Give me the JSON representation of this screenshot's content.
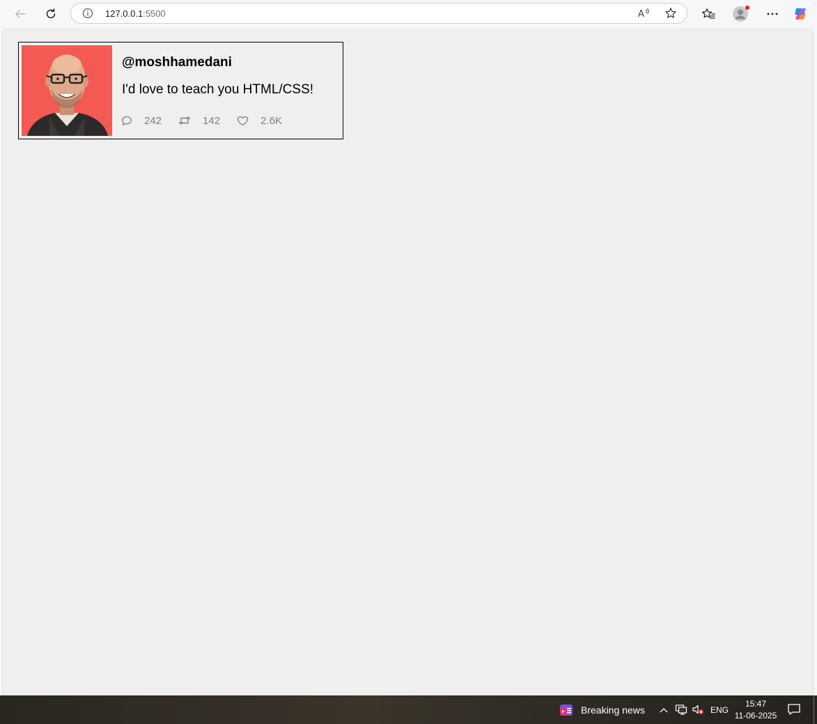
{
  "browser": {
    "url_host": "127.0.0.1",
    "url_port": ":5500",
    "icons": [
      "back-arrow-icon",
      "refresh-icon",
      "info-icon",
      "read-aloud-icon",
      "favorite-star-icon",
      "favorites-list-icon",
      "profile-avatar-icon",
      "more-icon",
      "copilot-icon"
    ]
  },
  "tweet": {
    "handle": "@moshhamedani",
    "message": "I'd love to teach you HTML/CSS!",
    "stats": {
      "replies": "242",
      "retweets": "142",
      "likes": "2.6K"
    },
    "photo_background": "#f2524c",
    "stat_color": "#7f7f7f"
  },
  "taskbar": {
    "news_label": "Breaking news",
    "language": "ENG",
    "time": "15:47",
    "date": "11-06-2025"
  }
}
